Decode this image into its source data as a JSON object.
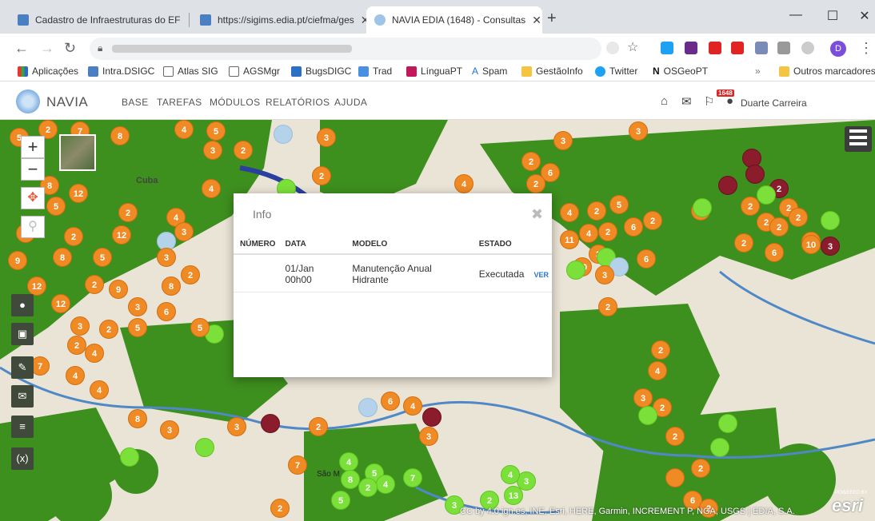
{
  "browser": {
    "tabs": [
      {
        "title": "Cadastro de Infraestruturas do EF",
        "active": false
      },
      {
        "title": "https://sigims.edia.pt/ciefma/ges",
        "active": false
      },
      {
        "title": "NAVIA EDIA (1648) - Consultas",
        "active": true
      }
    ],
    "bookmarks": [
      "Aplicações",
      "Intra.DSIGC",
      "Atlas SIG",
      "AGSMgr",
      "BugsDIGC",
      "Trad",
      "LínguaPT",
      "Spam",
      "GestãoInfo",
      "Twitter",
      "OSGeoPT",
      "Outros marcadores"
    ],
    "profile_initial": "D",
    "bookmarks_more": "»"
  },
  "app": {
    "name": "NAVIA",
    "menu": [
      "BASE",
      "TAREFAS",
      "MÓDULOS",
      "RELATÓRIOS",
      "AJUDA"
    ],
    "notification_count": "1648",
    "user": "Duarte Carreira"
  },
  "map": {
    "attribution": "CC by 4.0 ign.es, INE, Esri, HERE, Garmin, INCREMENT P, NGA, USGS | EDIA, S.A.",
    "esri_logo": "esri",
    "powered_by": "POWERED BY",
    "place_labels": [
      "Cuba",
      "São M"
    ],
    "zoom_in": "+",
    "zoom_out": "−"
  },
  "info_modal": {
    "title": "Info",
    "columns": [
      "NÚMERO",
      "DATA",
      "MODELO",
      "ESTADO",
      ""
    ],
    "rows": [
      {
        "numero": "",
        "data": "01/Jan 00h00",
        "modelo": "Manutenção Anual Hidrante",
        "estado": "Executada",
        "action": "VER"
      }
    ]
  },
  "colors": {
    "field_green": "#3d8f1e",
    "marker_orange": "#f08a24",
    "marker_lightgreen": "#7be03a",
    "marker_darkred": "#8a1c2c"
  }
}
